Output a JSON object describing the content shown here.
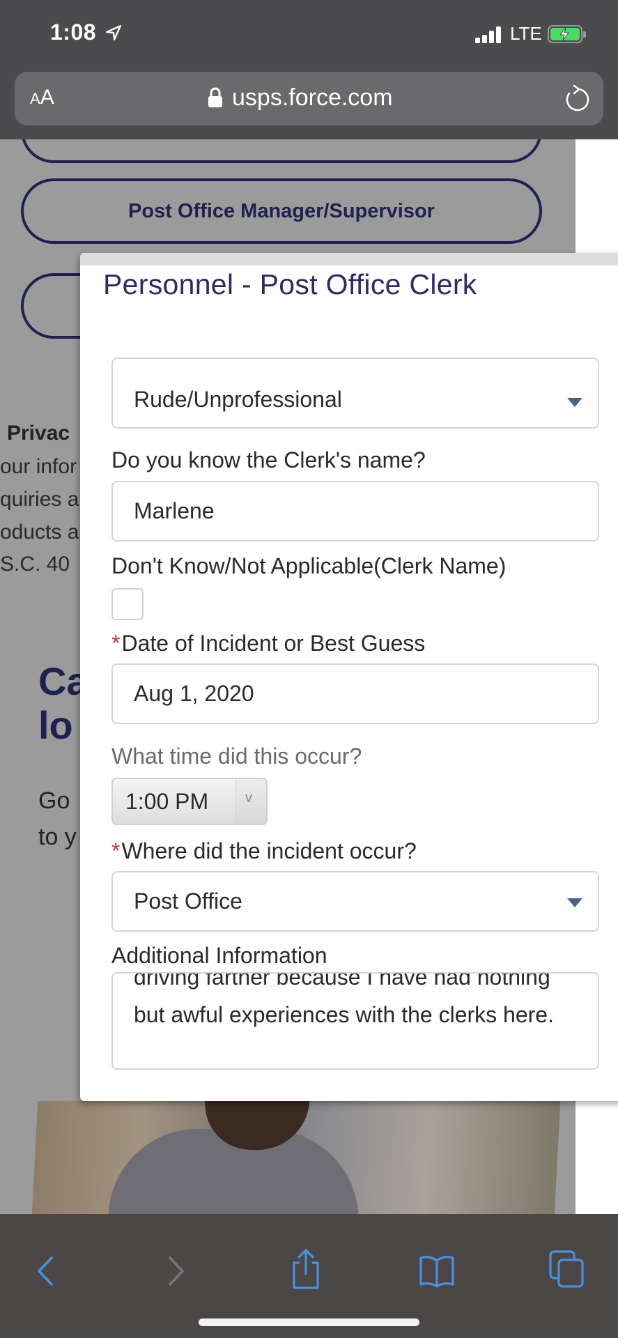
{
  "status_bar": {
    "time": "1:08",
    "network": "LTE",
    "icons": [
      "location-arrow-icon",
      "signal-bars-icon",
      "battery-charging-icon"
    ]
  },
  "browser": {
    "text_size_label_small": "A",
    "text_size_label_big": "A",
    "url": "usps.force.com",
    "icons": [
      "lock-icon",
      "reload-icon"
    ]
  },
  "background_page": {
    "buttons": [
      {
        "label": ""
      },
      {
        "label": "Post Office Manager/Supervisor"
      },
      {
        "label": ""
      }
    ],
    "privacy_heading": "Privac",
    "privacy_lines": [
      "our infor",
      "quiries a",
      "oducts a",
      "S.C. 40"
    ],
    "heading_lines": [
      "Ca",
      "lo"
    ],
    "body_lines": [
      "Go",
      "to y"
    ]
  },
  "modal": {
    "title": "Personnel - Post Office Clerk",
    "fields": {
      "issue_type": {
        "value": "Rude/Unprofessional"
      },
      "clerk_name": {
        "label": "Do you know the Clerk's name?",
        "value": "Marlene"
      },
      "clerk_unknown": {
        "label": "Don't Know/Not Applicable(Clerk Name)",
        "checked": false
      },
      "incident_date": {
        "required_mark": "*",
        "label": "Date of Incident or Best Guess",
        "value": "Aug 1, 2020"
      },
      "incident_time": {
        "label": "What time did this occur?",
        "value": "1:00 PM",
        "dropdown_glyph": "v"
      },
      "incident_location": {
        "required_mark": "*",
        "label": "Where did the incident occur?",
        "value": "Post Office"
      },
      "additional_info": {
        "label": "Additional Information",
        "value": "driving farther because I have had nothing but awful experiences with the clerks here."
      }
    }
  },
  "toolbar": {
    "items": [
      "back-icon",
      "forward-icon",
      "share-icon",
      "bookmarks-icon",
      "tabs-icon"
    ],
    "accent_color": "#4a90e2"
  }
}
